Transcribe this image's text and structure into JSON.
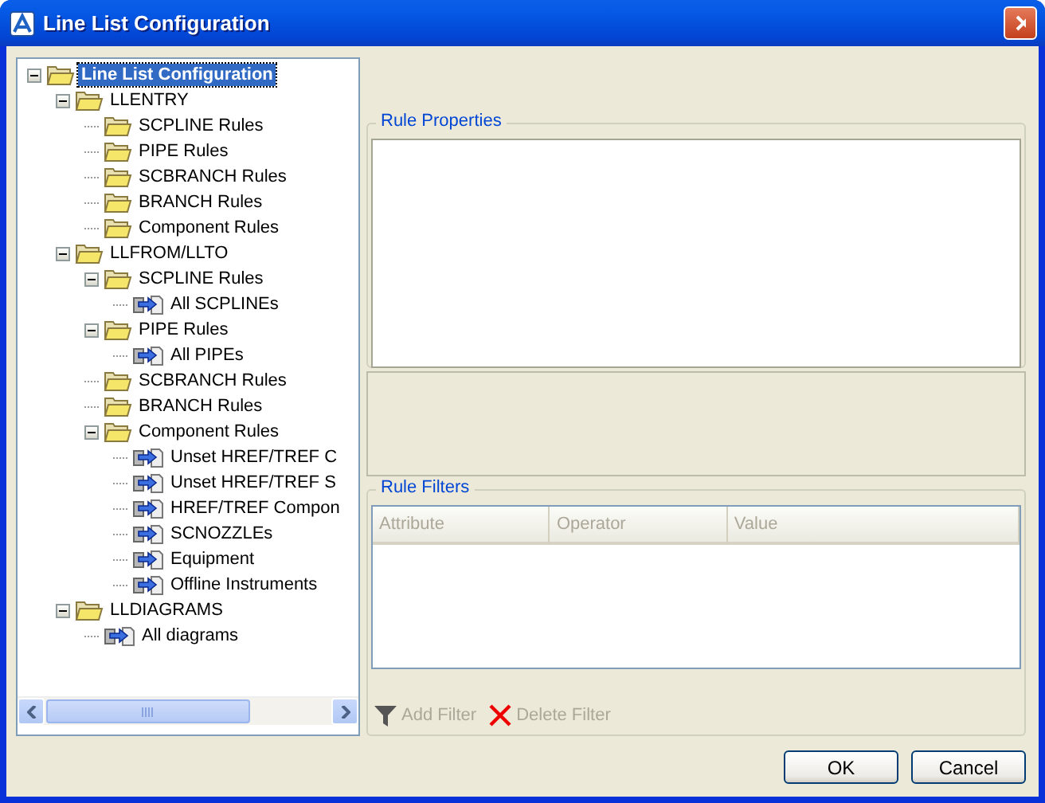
{
  "window": {
    "title": "Line List Configuration"
  },
  "tree": [
    {
      "label": "Line List Configuration",
      "kind": "folder",
      "expanded": true,
      "selected": true,
      "children": [
        {
          "label": "LLENTRY",
          "kind": "folder",
          "expanded": true,
          "selected": false,
          "children": [
            {
              "label": "SCPLINE Rules",
              "kind": "folder",
              "selected": false
            },
            {
              "label": "PIPE Rules",
              "kind": "folder",
              "selected": false
            },
            {
              "label": "SCBRANCH Rules",
              "kind": "folder",
              "selected": false
            },
            {
              "label": "BRANCH Rules",
              "kind": "folder",
              "selected": false
            },
            {
              "label": "Component Rules",
              "kind": "folder",
              "selected": false
            }
          ]
        },
        {
          "label": "LLFROM/LLTO",
          "kind": "folder",
          "expanded": true,
          "selected": false,
          "children": [
            {
              "label": "SCPLINE Rules",
              "kind": "folder",
              "expanded": true,
              "selected": false,
              "children": [
                {
                  "label": "All SCPLINEs",
                  "kind": "rule",
                  "selected": false
                }
              ]
            },
            {
              "label": "PIPE Rules",
              "kind": "folder",
              "expanded": true,
              "selected": false,
              "children": [
                {
                  "label": "All PIPEs",
                  "kind": "rule",
                  "selected": false
                }
              ]
            },
            {
              "label": "SCBRANCH Rules",
              "kind": "folder",
              "selected": false
            },
            {
              "label": "BRANCH Rules",
              "kind": "folder",
              "selected": false
            },
            {
              "label": "Component Rules",
              "kind": "folder",
              "expanded": true,
              "selected": false,
              "children": [
                {
                  "label": "Unset HREF/TREF C",
                  "kind": "rule",
                  "selected": false
                },
                {
                  "label": "Unset HREF/TREF S",
                  "kind": "rule",
                  "selected": false
                },
                {
                  "label": "HREF/TREF Compon",
                  "kind": "rule",
                  "selected": false
                },
                {
                  "label": "SCNOZZLEs",
                  "kind": "rule",
                  "selected": false
                },
                {
                  "label": "Equipment",
                  "kind": "rule",
                  "selected": false
                },
                {
                  "label": "Offline Instruments",
                  "kind": "rule",
                  "selected": false
                }
              ]
            }
          ]
        },
        {
          "label": "LLDIAGRAMS",
          "kind": "folder",
          "expanded": true,
          "selected": false,
          "children": [
            {
              "label": "All diagrams",
              "kind": "rule",
              "selected": false
            }
          ]
        }
      ]
    }
  ],
  "rule_properties": {
    "title": "Rule Properties"
  },
  "rule_filters": {
    "title": "Rule Filters",
    "columns": [
      "Attribute",
      "Operator",
      "Value"
    ],
    "actions": [
      {
        "kind": "add",
        "label": "Add Filter",
        "disabled": true
      },
      {
        "kind": "delete",
        "label": "Delete Filter",
        "disabled": true
      }
    ]
  },
  "buttons": [
    "OK",
    "Cancel"
  ]
}
